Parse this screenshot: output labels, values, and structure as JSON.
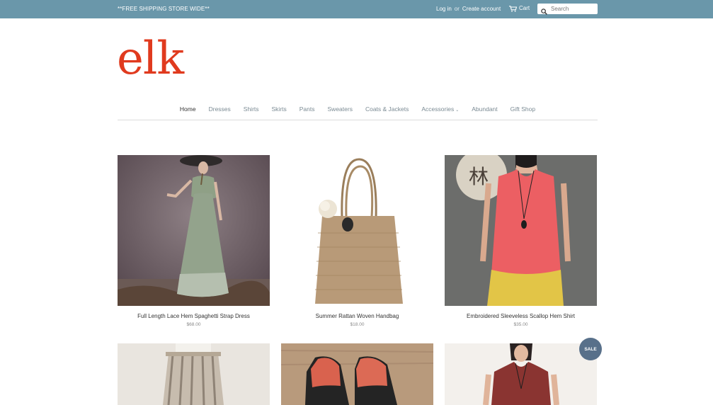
{
  "topbar": {
    "promo": "**FREE SHIPPING STORE WIDE**",
    "login": "Log in",
    "or": "or",
    "create_account": "Create account",
    "cart": "Cart",
    "search_placeholder": "Search"
  },
  "logo": "elk",
  "nav": {
    "items": [
      {
        "label": "Home"
      },
      {
        "label": "Dresses"
      },
      {
        "label": "Shirts"
      },
      {
        "label": "Skirts"
      },
      {
        "label": "Pants"
      },
      {
        "label": "Sweaters"
      },
      {
        "label": "Coats & Jackets"
      },
      {
        "label": "Accessories"
      },
      {
        "label": "Abundant"
      },
      {
        "label": "Gift Shop"
      }
    ],
    "dropdown_chevron": "⌄"
  },
  "products": [
    {
      "title": "Full Length Lace Hem Spaghetti Strap Dress",
      "price": "$68.00"
    },
    {
      "title": "Summer Rattan Woven Handbag",
      "price": "$18.00"
    },
    {
      "title": "Embroidered Sleeveless Scallop Hem Shirt",
      "price": "$35.00"
    }
  ],
  "badges": {
    "sale": "SALE"
  },
  "colors": {
    "topbar": "#6a97aa",
    "logo": "#e03a1e",
    "sale_badge": "#58708a"
  }
}
